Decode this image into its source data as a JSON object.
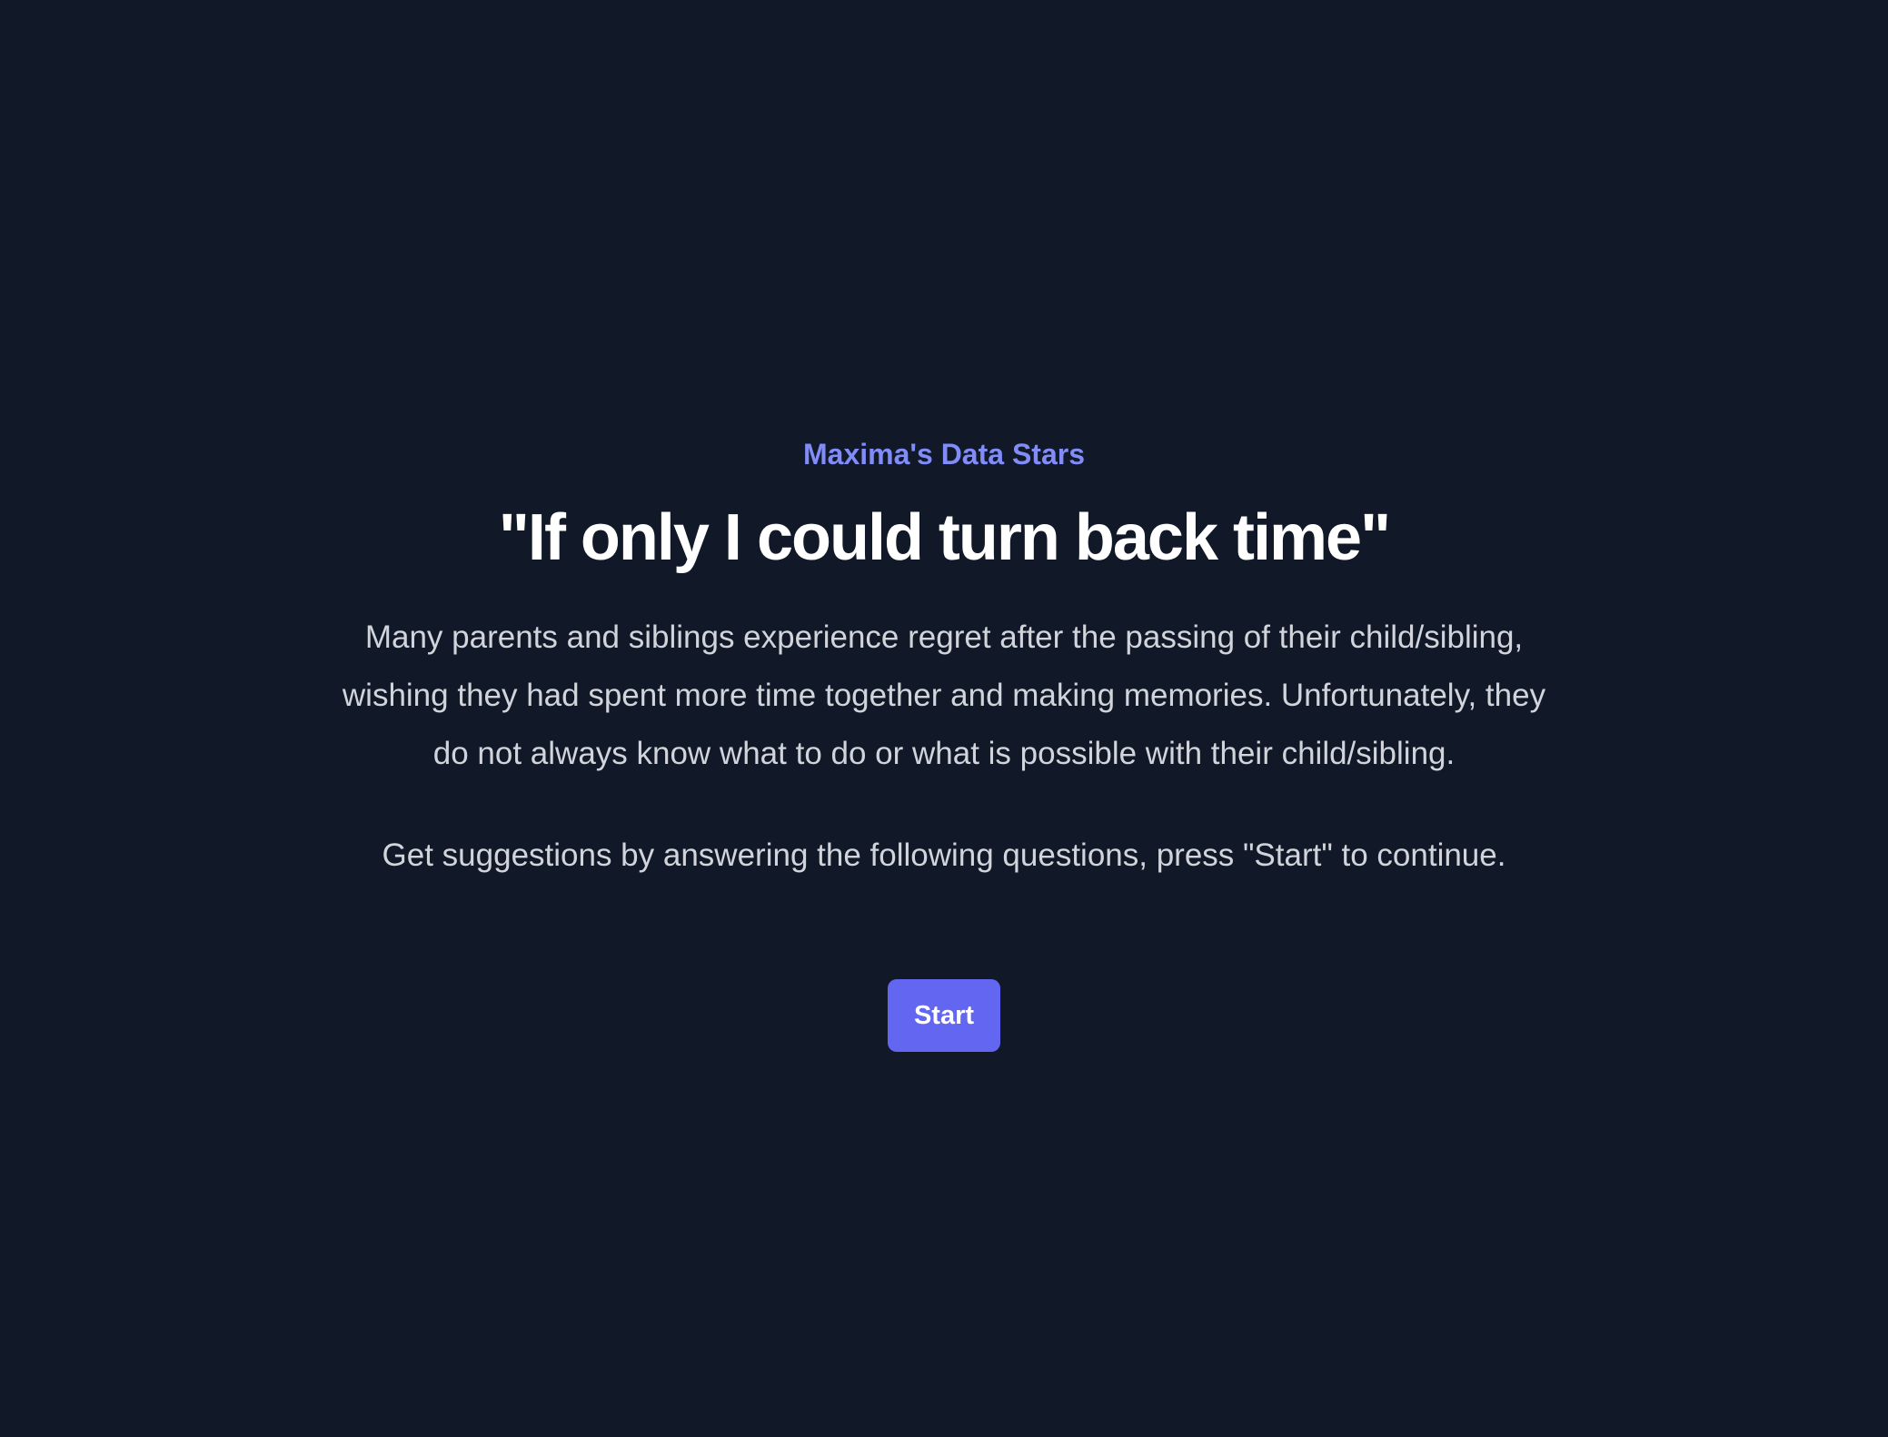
{
  "header": {
    "eyebrow": "Maxima's Data Stars",
    "title": "\"If only I could turn back time\""
  },
  "main": {
    "description": "Many parents and siblings experience regret after the passing of their child/sibling, wishing they had spent more time together and making memories. Unfortunately, they do not always know what to do or what is possible with their child/sibling.",
    "instruction": "Get suggestions by answering the following questions, press \"Start\" to continue.",
    "start_button_label": "Start"
  },
  "colors": {
    "background": "#111827",
    "accent": "#818cf8",
    "button": "#6366f1",
    "body_text": "#d1d5db",
    "title_text": "#ffffff"
  }
}
